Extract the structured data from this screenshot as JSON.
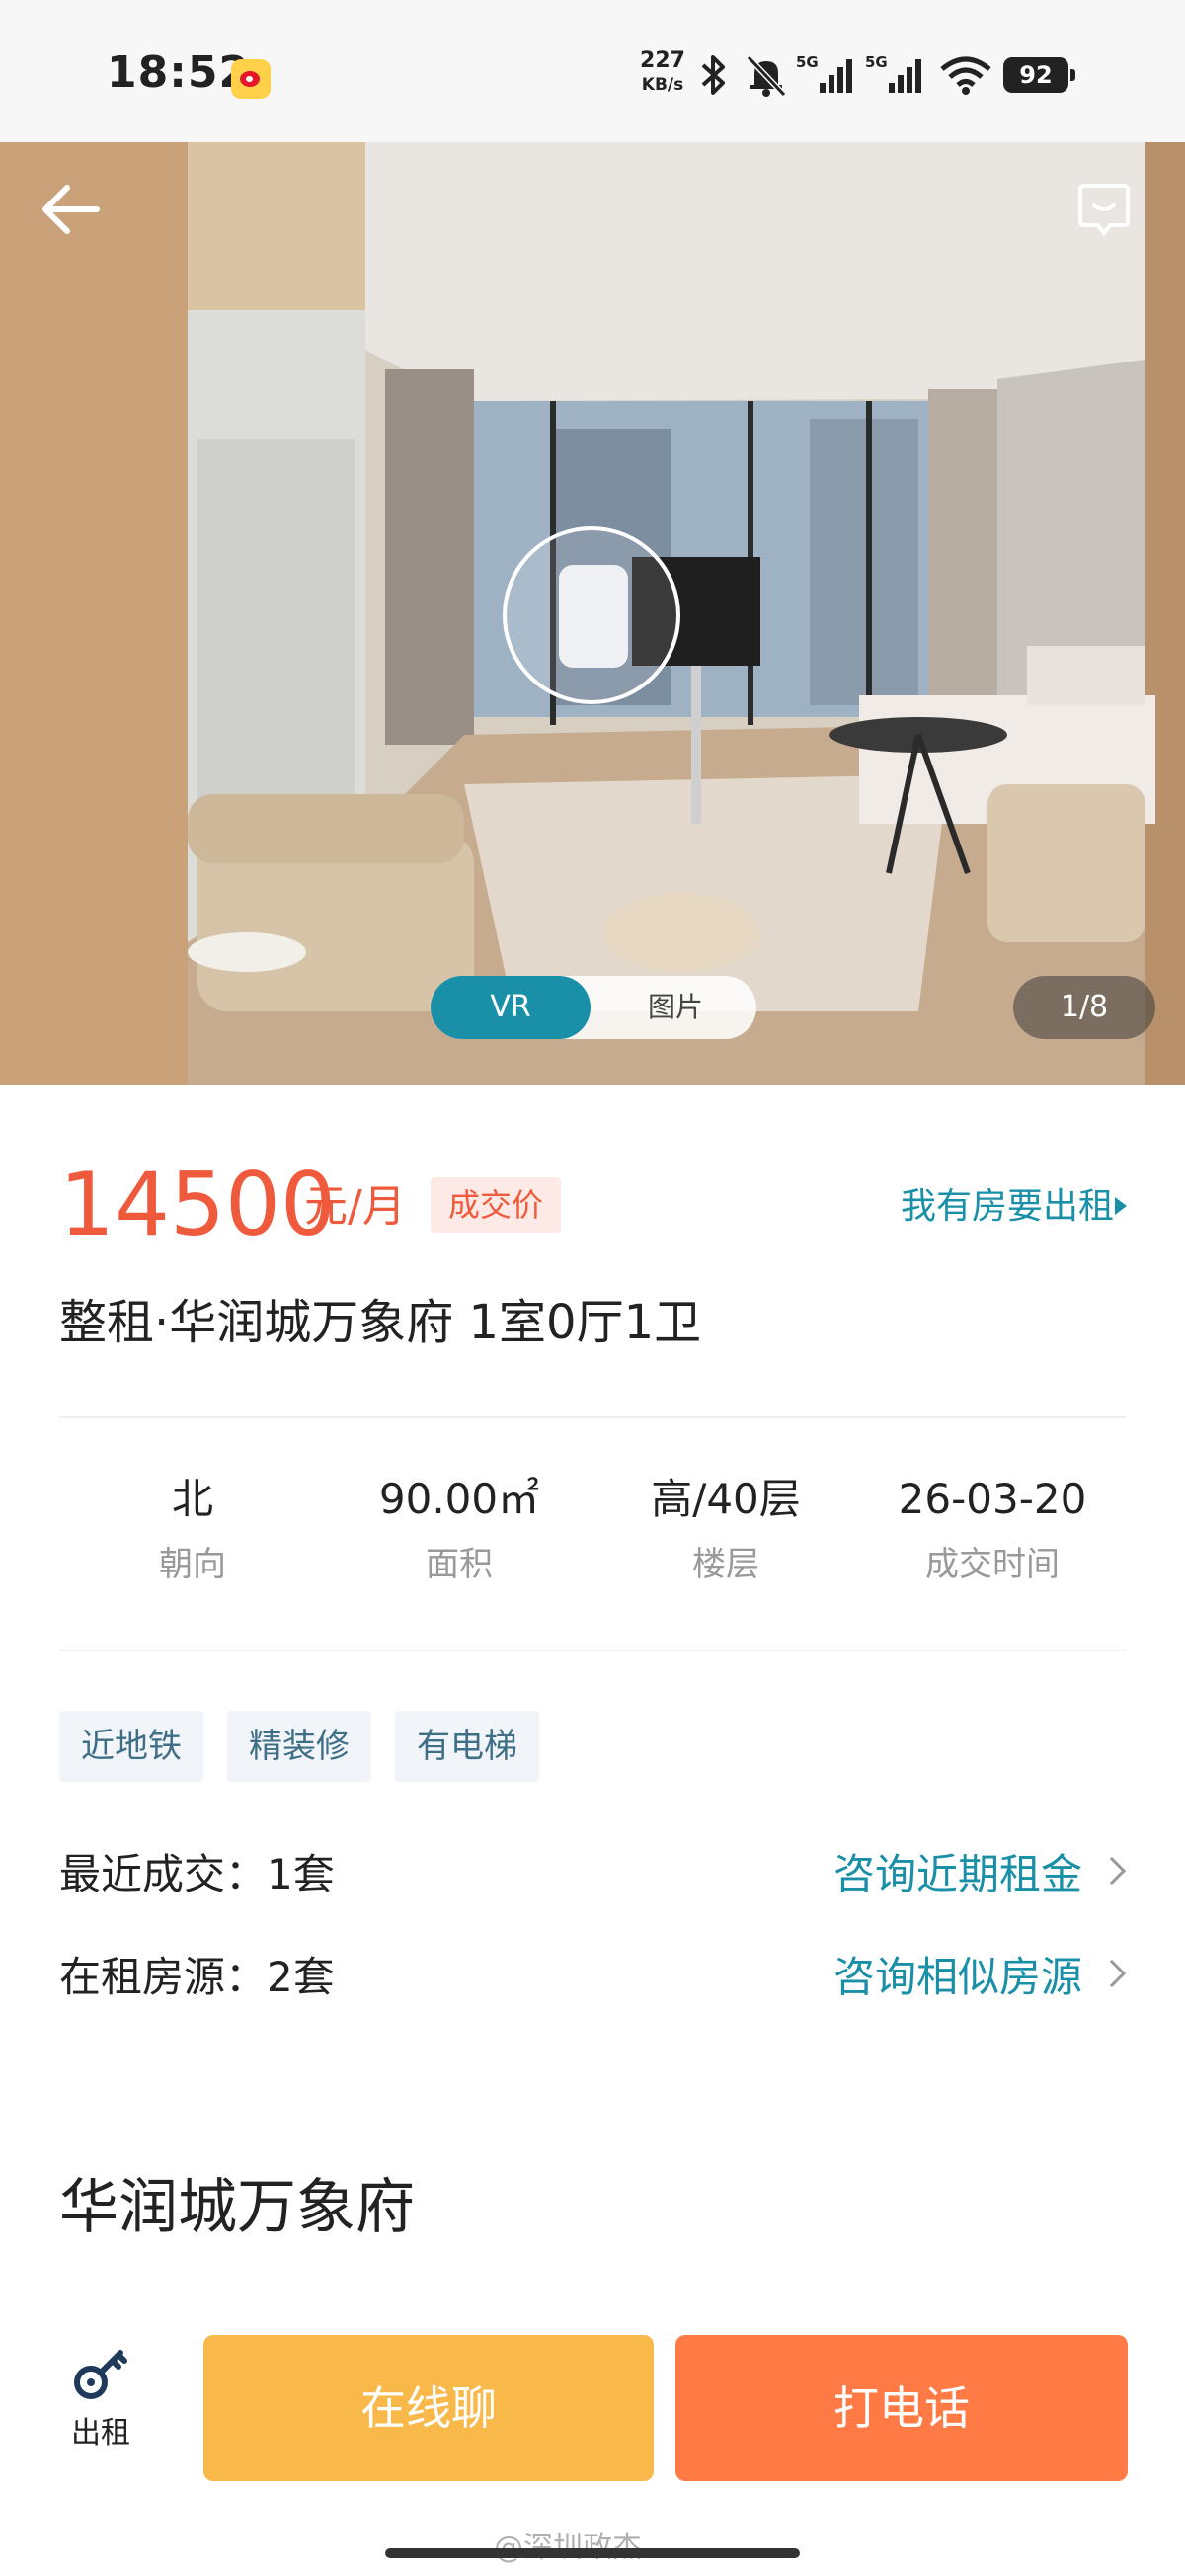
{
  "status_bar": {
    "time": "18:52",
    "net_speed_value": "227",
    "net_speed_unit": "KB/s",
    "battery": "92",
    "icons": [
      "weibo-app-icon",
      "bluetooth-icon",
      "mute-bell-icon",
      "signal-5g-icon",
      "signal-5g-icon",
      "wifi-icon",
      "battery-icon"
    ]
  },
  "gallery": {
    "tab_vr": "VR",
    "tab_photos": "图片",
    "counter": "1/8",
    "icons": [
      "back-arrow-icon",
      "chat-bubble-icon",
      "vr-pano-icon"
    ]
  },
  "listing": {
    "price": "14500",
    "price_unit": "元/月",
    "price_badge": "成交价",
    "rent_out_link": "我有房要出租",
    "title": "整租·华润城万象府 1室0厅1卫",
    "stats": [
      {
        "value": "北",
        "label": "朝向"
      },
      {
        "value": "90.00㎡",
        "label": "面积"
      },
      {
        "value": "高/40层",
        "label": "楼层"
      },
      {
        "value": "26-03-20",
        "label": "成交时间"
      }
    ],
    "tags": [
      "近地铁",
      "精装修",
      "有电梯"
    ],
    "recent_deals_label": "最近成交：1套",
    "recent_deals_link": "咨询近期租金",
    "active_rentals_label": "在租房源：2套",
    "active_rentals_link": "咨询相似房源",
    "community_name": "华润城万象府"
  },
  "bottom_bar": {
    "rent_tab_label": "出租",
    "chat_button": "在线聊",
    "call_button": "打电话"
  },
  "watermark": "@深圳政杰",
  "colors": {
    "price": "#ef5a3c",
    "link": "#1a8fa8",
    "chat_button": "#f9b84a",
    "call_button": "#ff7a45",
    "tag_bg": "#f1f4f8"
  }
}
